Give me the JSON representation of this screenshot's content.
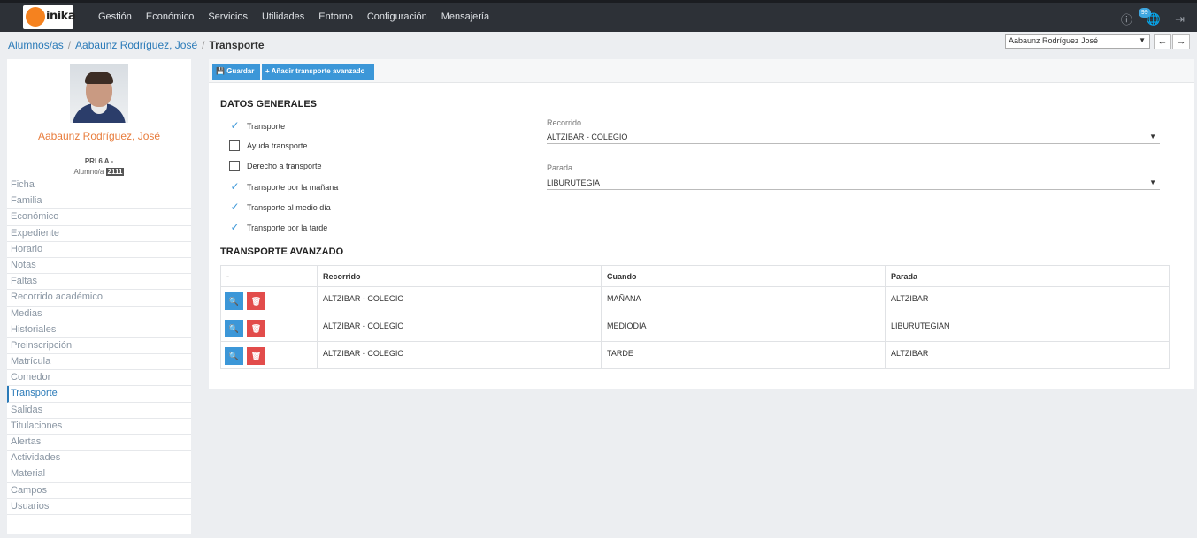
{
  "app": {
    "logo_text": "inika"
  },
  "topnav": {
    "items": [
      "Gestión",
      "Económico",
      "Servicios",
      "Utilidades",
      "Entorno",
      "Configuración",
      "Mensajería"
    ],
    "icons": [
      "help-icon",
      "globe-icon",
      "logout-icon"
    ],
    "badge": "99"
  },
  "breadcrumb": {
    "items": [
      "Alumnos/as",
      "Aabaunz Rodríguez, José"
    ],
    "current": "Transporte"
  },
  "student_selector": {
    "value": "Aabaunz Rodríguez José"
  },
  "student": {
    "name": "Aabaunz Rodríguez, José",
    "group": "PRI 6 A -",
    "id_label": "Alumno/a",
    "id_number": "2111"
  },
  "menu": {
    "items": [
      "Ficha",
      "Familia",
      "Económico",
      "Expediente",
      "Horario",
      "Notas",
      "Faltas",
      "Recorrido académico",
      "Medias",
      "Historiales",
      "Preinscripción",
      "Matrícula",
      "Comedor",
      "Transporte",
      "Salidas",
      "Titulaciones",
      "Alertas",
      "Actividades",
      "Material",
      "Campos",
      "Usuarios"
    ],
    "active": "Transporte"
  },
  "toolbar": {
    "save_label": "Guardar",
    "add_label": "Añadir transporte avanzado"
  },
  "general": {
    "title": "DATOS GENERALES",
    "checks": [
      {
        "label": "Transporte",
        "checked": true
      },
      {
        "label": "Ayuda transporte",
        "checked": false
      },
      {
        "label": "Derecho a transporte",
        "checked": false
      },
      {
        "label": "Transporte por la mañana",
        "checked": true
      },
      {
        "label": "Transporte al medio día",
        "checked": true
      },
      {
        "label": "Transporte por la tarde",
        "checked": true
      }
    ],
    "route_label": "Recorrido",
    "route_value": "ALTZIBAR - COLEGIO",
    "stop_label": "Parada",
    "stop_value": "LIBURUTEGIA"
  },
  "advanced": {
    "title": "TRANSPORTE AVANZADO",
    "columns": [
      "-",
      "Recorrido",
      "Cuando",
      "Parada"
    ],
    "rows": [
      {
        "recorrido": "ALTZIBAR - COLEGIO",
        "cuando": "MAÑANA",
        "parada": "ALTZIBAR"
      },
      {
        "recorrido": "ALTZIBAR - COLEGIO",
        "cuando": "MEDIODIA",
        "parada": "LIBURUTEGIAN"
      },
      {
        "recorrido": "ALTZIBAR - COLEGIO",
        "cuando": "TARDE",
        "parada": "ALTZIBAR"
      }
    ]
  },
  "colors": {
    "topbar": "#2d3137",
    "accent": "#3c97d8",
    "danger": "#e24c4b",
    "student_name": "#e87c3c"
  }
}
